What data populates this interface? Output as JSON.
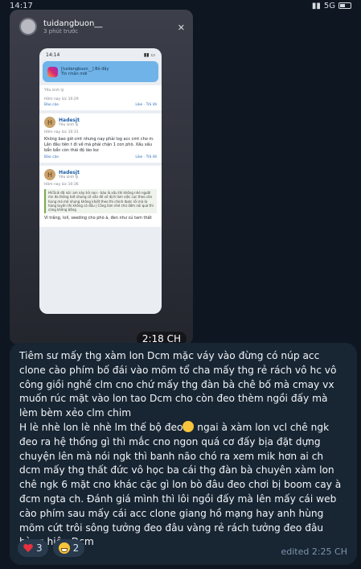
{
  "status_bar": {
    "time": "14:17",
    "network": "5G",
    "signal": "▮▮"
  },
  "story": {
    "username": "tuidangbuon__",
    "posted": "3 phút trước",
    "close_glyph": "✕",
    "duration": "2:18 CH"
  },
  "inner_phone": {
    "time": "14:14",
    "notification_title": "[tuidangbuon__] Bỏ đây",
    "notification_body": "Tin nhắn mới",
    "posts": [
      {
        "meta": "Hôm nay lúc 10:29",
        "name": "",
        "rank": "Yếu sinh lý",
        "body": "",
        "report": "Báo cáo",
        "like": "Like",
        "reply": "Trả lời"
      },
      {
        "meta": "Hôm nay lúc 10:31",
        "name": "Hadesjt",
        "rank": "Yếu sinh lý",
        "body": "Không bao giờ cmt nhưng nay phải log acc cmt cho m. Lần đầu tiên t đi về mà phải chặn 1 con phò. Xấu xấu bẩn bẩn còn thái độ láo loz",
        "report": "Báo cáo",
        "like": "Like",
        "reply": "Trả lời"
      },
      {
        "meta": "Hôm nay lúc 10:36",
        "name": "Hadesjt",
        "rank": "Yếu sinh lý",
        "quote": "HV1kik đã nói: am này trò nọn - báo là xấu thì không nhé người mn đa thông tolt nhưng cô vẫn đề về dịch làm việc cực theo căn hùng mà mô nhưng không khiết theo thì chinh được rồi mà là hàng tuyến thì không có đầu | Công làm nhé chứ dớm nói quá thì cũng không bằng",
        "body": "Vì trắng, lolí, seeding cho phò à, đen như củ tam thất",
        "report": "Báo cáo",
        "like": "Like",
        "reply": "Trả lời"
      }
    ]
  },
  "message": {
    "text": "Tiêm sư mấy thg xàm lon Dcm mặc váy vào đừng có núp acc clone cào phím bố đái vào mõm tổ cha mấy thg rẻ rách vô hc vô công giồi nghề clm cno chứ mấy thg đàn bà chê bố mà cmay vx muốn rúc mặt vào lon tao Dcm cho còn đeo thèm ngồi đấy mà lèm bèm xẻo clm chim\nH lè nhè lon lè nhè lm thế bộ đeo",
    "text_after_emoji": " ngai à xàm lon vcl chê ngk đeo ra hệ thống gì thì mắc cno ngon quá cơ đấy bịa đặt dựng chuyện lên mà nói ngk thì banh não chó ra xem mik hơn ai ch dcm mấy thg thất đức vô học ba cái thg đàn bà chuyên xàm lon chê ngk 6 mặt cno khác cặc gì lon bò đâu đeo chơi bị boom cay à đcm ngta ch. Đánh giá mình thì lôi ngồi đấy mà lên mấy cái web cào phím sau mấy cái acc clone giang hồ mạng hay anh hùng mõm cứt trôi sông tưởng đeo đâu vàng rẻ rách tưởng đeo đâu hàng hiệu Dcm",
    "reactions": [
      {
        "icon": "heart-icon",
        "count": "3"
      },
      {
        "icon": "grinning-face-icon",
        "count": "2"
      }
    ],
    "edited": "edited 2:25 CH"
  }
}
